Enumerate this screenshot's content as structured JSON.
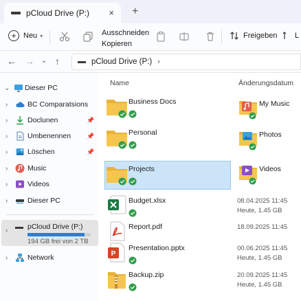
{
  "window": {
    "tab_title": "pCloud Drive (P:)",
    "close_glyph": "×",
    "new_tab_glyph": "+"
  },
  "toolbar": {
    "new_label": "Neu",
    "cut_label": "Ausschneiden",
    "copy_label": "Kopieren",
    "share_label": "Freigeben",
    "more_label": "L"
  },
  "address": {
    "path": "pCloud Drive (P:)",
    "chevron": "›"
  },
  "sidebar": {
    "items": [
      {
        "label": "Dieser PC",
        "icon": "monitor-icon",
        "expanded": true
      },
      {
        "label": "BC Comparatsions",
        "icon": "cloud-icon"
      },
      {
        "label": "Doclunen",
        "icon": "download-icon"
      },
      {
        "label": "Umbenennen",
        "icon": "document-icon"
      },
      {
        "label": "Löschen",
        "icon": "image-icon"
      },
      {
        "label": "Music",
        "icon": "music-icon"
      },
      {
        "label": "Videos",
        "icon": "video-icon"
      },
      {
        "label": "Dieser PC",
        "icon": "drive-icon"
      }
    ],
    "drive": {
      "label": "pCloud Drive (P:)",
      "capacity": "194 GB frei von 2 TB",
      "used_fraction": 0.9
    },
    "network": {
      "label": "Network",
      "icon": "network-icon"
    }
  },
  "content": {
    "columns": {
      "name": "Name",
      "date": "Änderungsdatum"
    },
    "items": [
      {
        "name": "Business Docs",
        "type": "folder",
        "date": "",
        "size": ""
      },
      {
        "name": "Personal",
        "type": "folder",
        "date": "",
        "size": ""
      },
      {
        "name": "Projects",
        "type": "folder",
        "selected": true,
        "date": "",
        "size": ""
      },
      {
        "name": "Budget.xlsx",
        "type": "excel",
        "date": "08.04.2025 11:45",
        "size": "Heute, 1.45 GB"
      },
      {
        "name": "Report.pdf",
        "type": "pdf",
        "date": "18.09.2025 11:45",
        "size": ""
      },
      {
        "name": "Presentation.pptx",
        "type": "powerpoint",
        "date": "00.06.2025 11:45",
        "size": "Heute, 1.45 GB"
      },
      {
        "name": "Backup.zip",
        "type": "zip",
        "date": "20.09.2025 11:45",
        "size": "Heute, 1.45 GB"
      }
    ],
    "right_items": [
      {
        "name": "My Music",
        "icon": "music-folder-icon"
      },
      {
        "name": "Photos",
        "icon": "photos-folder-icon"
      },
      {
        "name": "Videos",
        "icon": "videos-folder-icon"
      }
    ]
  },
  "colors": {
    "accent": "#2a7fd4",
    "selection": "#cce4f7",
    "sync_green": "#2e9e4a",
    "folder": "#f5c550"
  }
}
